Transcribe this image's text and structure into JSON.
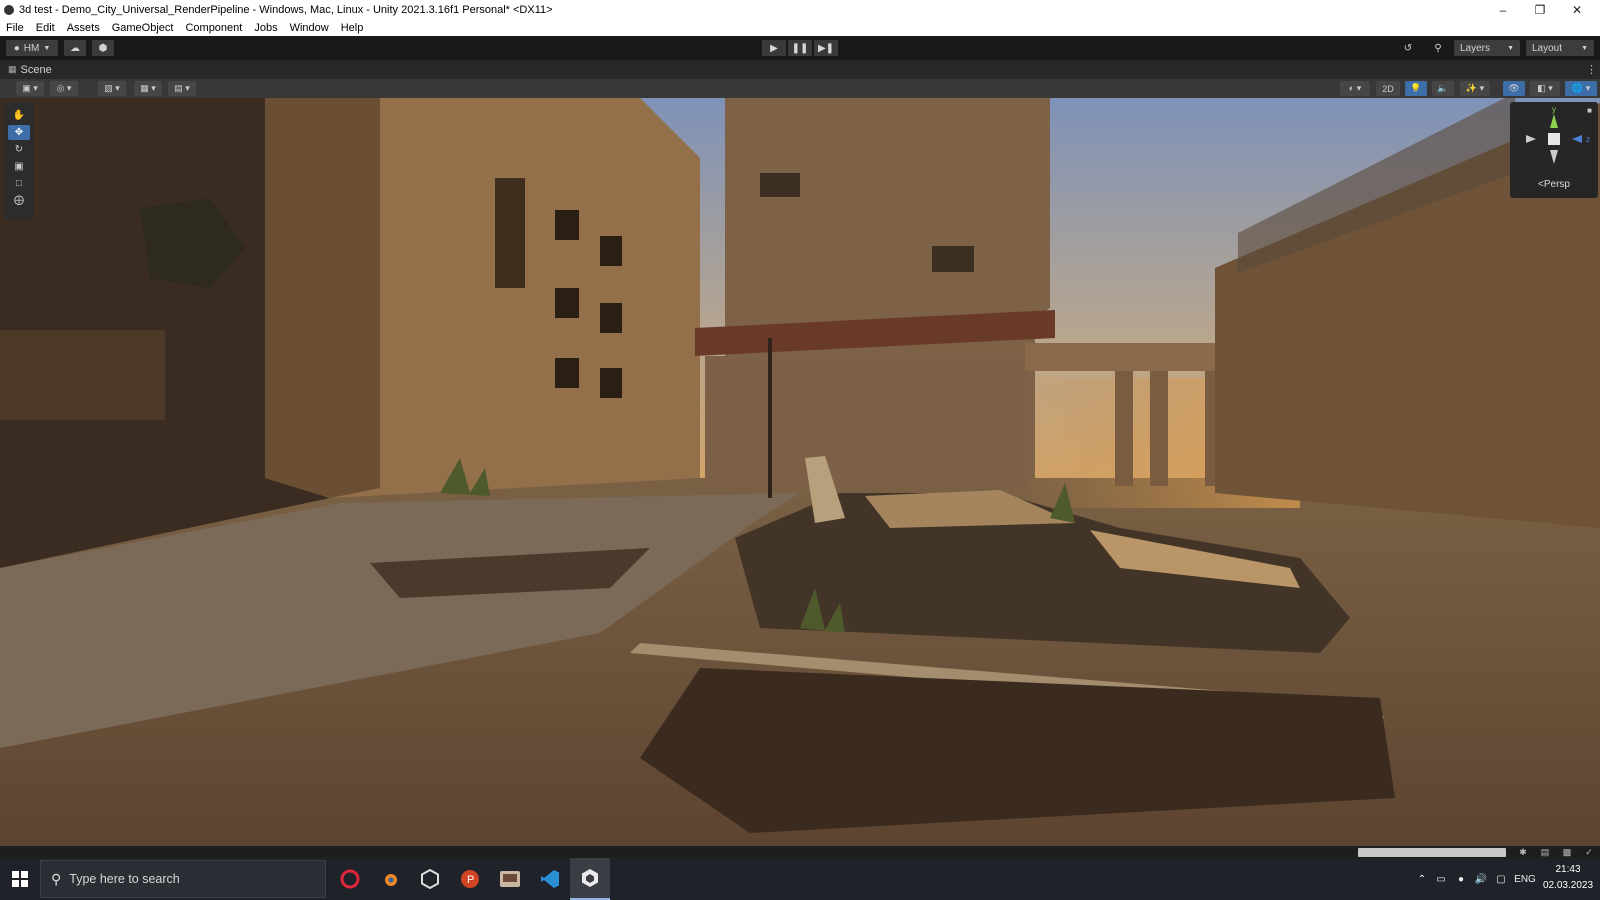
{
  "window": {
    "title": "3d test - Demo_City_Universal_RenderPipeline - Windows, Mac, Linux - Unity 2021.3.16f1 Personal* <DX11>",
    "minimize_icon": "minimize-icon",
    "restore_icon": "restore-icon",
    "close_icon": "close-icon"
  },
  "menu": {
    "items": [
      "File",
      "Edit",
      "Assets",
      "GameObject",
      "Component",
      "Jobs",
      "Window",
      "Help"
    ]
  },
  "toolbar": {
    "account_label": "HM",
    "cloud_icon": "cloud-icon",
    "collab_icon": "collab-icon",
    "play_icon": "play-icon",
    "pause_icon": "pause-icon",
    "step_icon": "step-icon",
    "history_icon": "history-icon",
    "search_icon": "search-icon",
    "layers_label": "Layers",
    "layout_label": "Layout"
  },
  "scene": {
    "tab_label": "Scene",
    "toggle_2d_label": "2D",
    "gizmo_label": "Persp",
    "gizmo_axis_y": "y",
    "gizmo_axis_z": "z"
  },
  "tools": [
    "hand-tool-icon",
    "move-tool-icon",
    "rotate-tool-icon",
    "scale-tool-icon",
    "rect-tool-icon",
    "transform-tool-icon"
  ],
  "taskbar": {
    "search_placeholder": "Type here to search",
    "apps": [
      "opera-icon",
      "blender-icon",
      "unity-hub-icon",
      "powerpoint-icon",
      "photo-app-icon",
      "vscode-icon",
      "unity-icon"
    ],
    "language": "ENG",
    "time": "21:43",
    "date": "02.03.2023"
  },
  "colors": {
    "editor_dark": "#191919",
    "scene_toolbar": "#383838",
    "active_tool": "#3e6ea8",
    "taskbar": "#1f2228"
  }
}
